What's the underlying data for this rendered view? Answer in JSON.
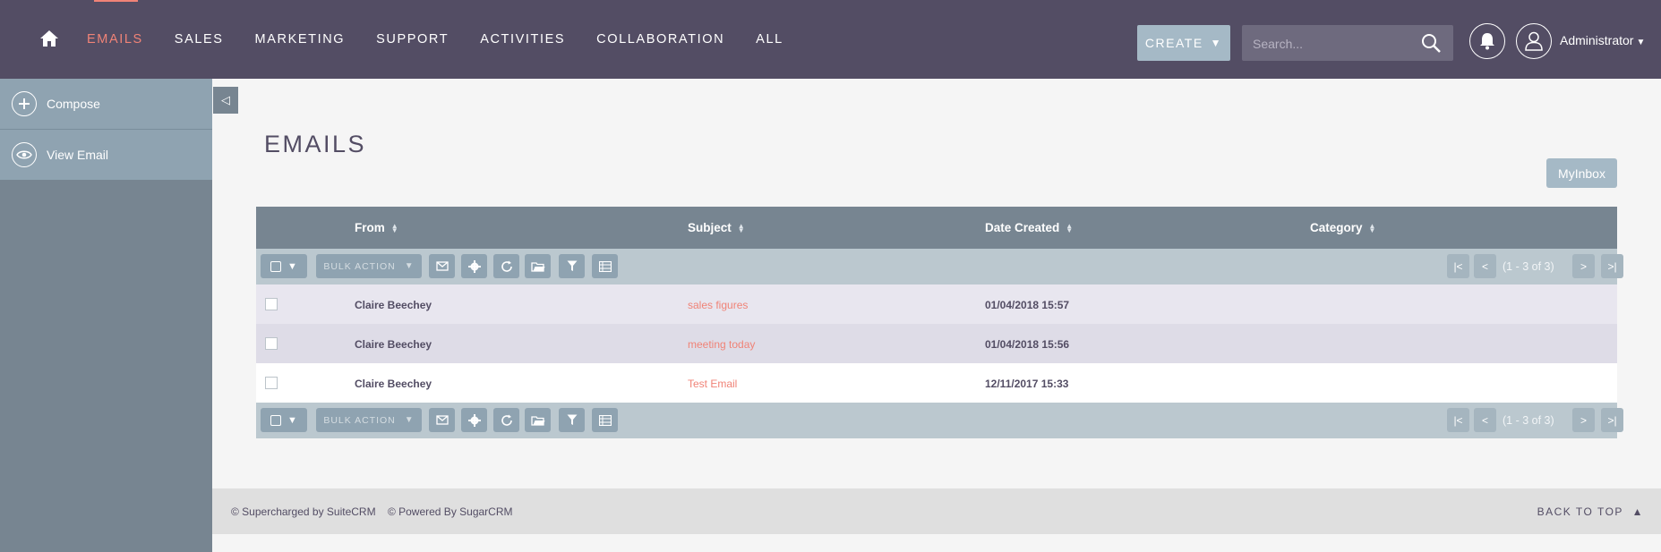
{
  "nav": {
    "items": [
      "EMAILS",
      "SALES",
      "MARKETING",
      "SUPPORT",
      "ACTIVITIES",
      "COLLABORATION",
      "ALL"
    ],
    "active_index": 0,
    "create_label": "CREATE",
    "search_placeholder": "Search...",
    "user_name": "Administrator"
  },
  "sidebar": {
    "items": [
      {
        "label": "Compose",
        "icon": "plus-icon"
      },
      {
        "label": "View Email",
        "icon": "eye-icon"
      }
    ]
  },
  "page": {
    "title": "EMAILS",
    "myinbox_label": "MyInbox"
  },
  "table": {
    "columns": [
      "From",
      "Subject",
      "Date Created",
      "Category"
    ],
    "bulk_action_label": "BULK ACTION",
    "pagination_text": "(1 - 3 of 3)",
    "rows": [
      {
        "from": "Claire Beechey",
        "subject": "sales figures",
        "date": "01/04/2018 15:57",
        "category": ""
      },
      {
        "from": "Claire Beechey",
        "subject": "meeting today",
        "date": "01/04/2018 15:56",
        "category": ""
      },
      {
        "from": "Claire Beechey",
        "subject": "Test Email",
        "date": "12/11/2017 15:33",
        "category": ""
      }
    ]
  },
  "footer": {
    "supercharged": "© Supercharged by SuiteCRM",
    "powered": "© Powered By SugarCRM",
    "back_to_top": "BACK TO TOP"
  },
  "colors": {
    "topbar": "#534d64",
    "accent": "#f08377",
    "sidebar": "#778591",
    "button": "#a5b9c6"
  }
}
